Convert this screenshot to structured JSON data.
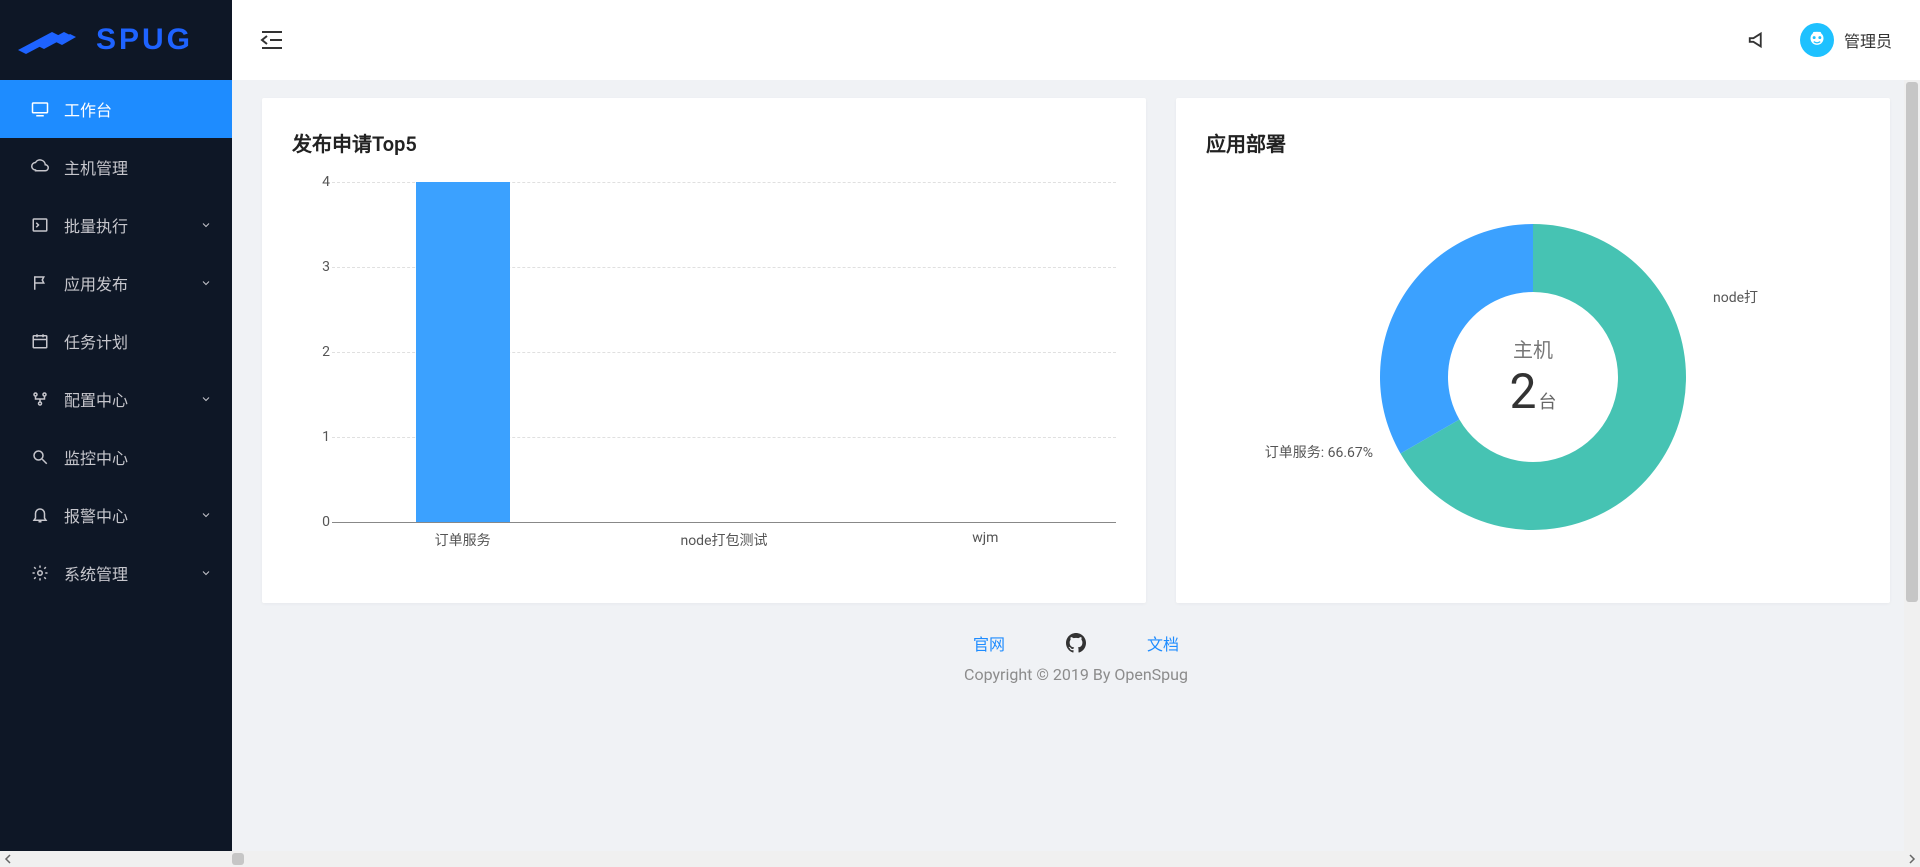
{
  "brand": "SPUG",
  "sidebar": {
    "items": [
      {
        "label": "工作台",
        "expandable": false
      },
      {
        "label": "主机管理",
        "expandable": false
      },
      {
        "label": "批量执行",
        "expandable": true
      },
      {
        "label": "应用发布",
        "expandable": true
      },
      {
        "label": "任务计划",
        "expandable": false
      },
      {
        "label": "配置中心",
        "expandable": true
      },
      {
        "label": "监控中心",
        "expandable": false
      },
      {
        "label": "报警中心",
        "expandable": true
      },
      {
        "label": "系统管理",
        "expandable": true
      }
    ],
    "active_index": 0
  },
  "header": {
    "user_name": "管理员"
  },
  "cards": {
    "bar_title": "发布申请Top5",
    "pie_title": "应用部署"
  },
  "donut": {
    "center_label": "主机",
    "center_value": "2",
    "center_unit": "台",
    "label_right": "node打",
    "label_left": "订单服务: 66.67%"
  },
  "footer": {
    "link_home": "官网",
    "link_docs": "文档",
    "copyright": "Copyright © 2019 By OpenSpug"
  },
  "chart_data": [
    {
      "type": "bar",
      "title": "发布申请Top5",
      "categories": [
        "订单服务",
        "node打包测试",
        "wjm"
      ],
      "values": [
        4,
        0,
        0
      ],
      "ylim": [
        0,
        4
      ],
      "y_ticks": [
        0,
        1,
        2,
        3,
        4
      ],
      "xlabel": "",
      "ylabel": ""
    },
    {
      "type": "pie",
      "title": "应用部署",
      "center_label": "主机",
      "center_value": 2,
      "center_unit": "台",
      "series": [
        {
          "name": "订单服务",
          "value": 66.67,
          "color": "#46c3b3"
        },
        {
          "name": "node打",
          "value": 33.33,
          "color": "#3ba1ff"
        }
      ]
    }
  ]
}
